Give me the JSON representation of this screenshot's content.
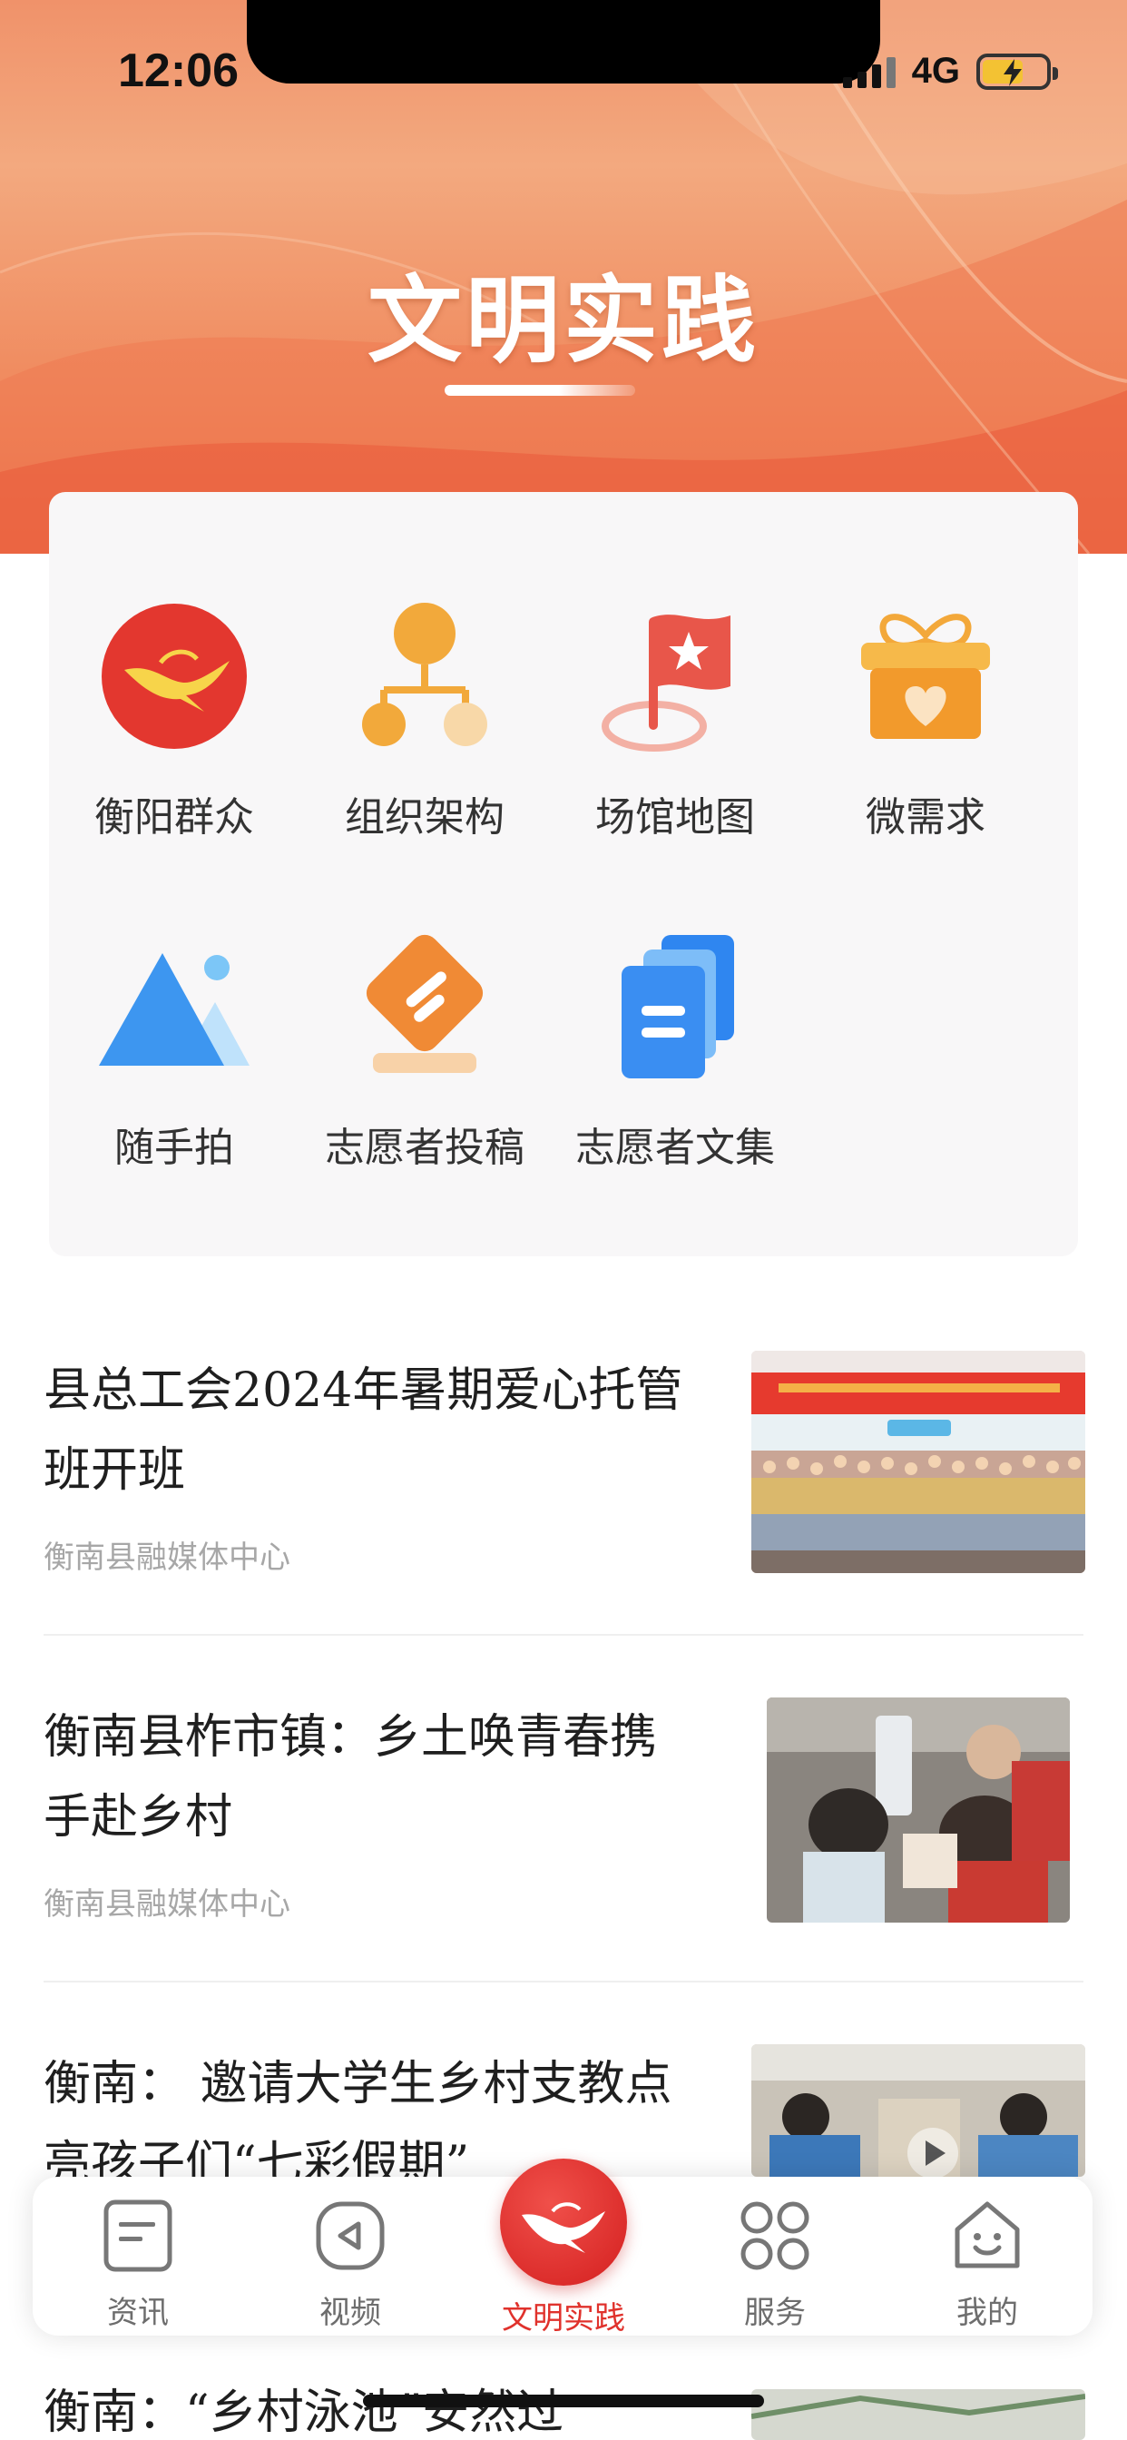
{
  "status_bar": {
    "time": "12:06",
    "network": "4G"
  },
  "header": {
    "title": "文明实践"
  },
  "grid": [
    {
      "label": "衡阳群众",
      "icon": "crane-logo-icon"
    },
    {
      "label": "组织架构",
      "icon": "org-chart-icon"
    },
    {
      "label": "场馆地图",
      "icon": "flag-map-icon"
    },
    {
      "label": "微需求",
      "icon": "gift-heart-icon"
    },
    {
      "label": "随手拍",
      "icon": "mountain-photo-icon"
    },
    {
      "label": "志愿者投稿",
      "icon": "submission-icon"
    },
    {
      "label": "志愿者文集",
      "icon": "documents-icon"
    }
  ],
  "news": [
    {
      "title": "县总工会2024年暑期爱心托管班开班",
      "source": "衡南县融媒体中心"
    },
    {
      "title": "衡南县柞市镇：乡土唤青春携手赴乡村",
      "source": "衡南县融媒体中心"
    },
    {
      "title": "衡南： 邀请大学生乡村支教点亮孩子们“七彩假期”",
      "source": ""
    },
    {
      "title": "衡南：“乡村泳池”安然过",
      "source": ""
    }
  ],
  "tabbar": [
    {
      "label": "资讯",
      "icon": "news-icon"
    },
    {
      "label": "视频",
      "icon": "video-play-icon"
    },
    {
      "label": "文明实践",
      "icon": "crane-logo-icon"
    },
    {
      "label": "服务",
      "icon": "services-grid-icon"
    },
    {
      "label": "我的",
      "icon": "profile-home-icon"
    }
  ],
  "colors": {
    "accent": "#e0322c",
    "hero": "#f0926a"
  }
}
